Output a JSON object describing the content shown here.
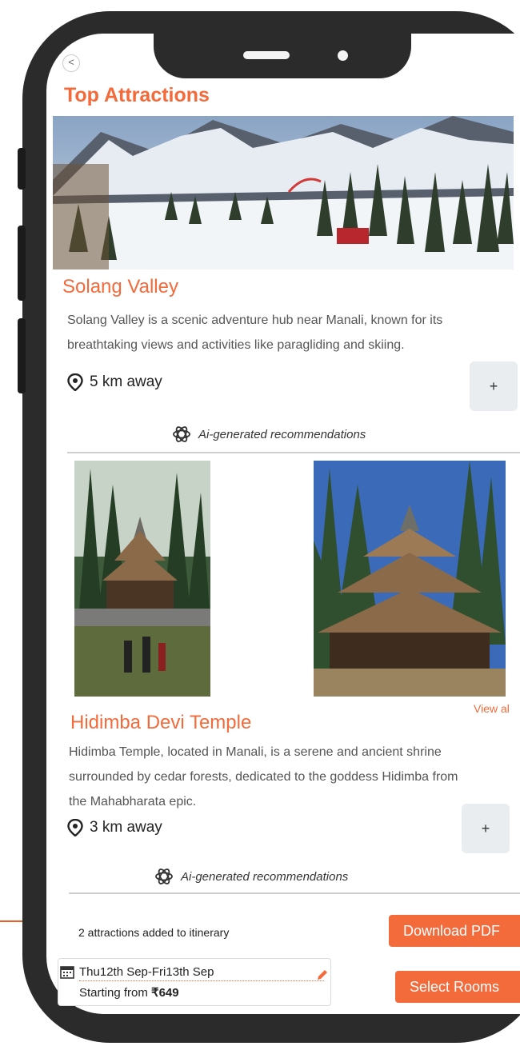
{
  "header": {
    "title": "Top Attractions",
    "back_label": "<"
  },
  "attractions": [
    {
      "name": "Solang Valley",
      "description_lines": [
        "Solang Valley is a scenic adventure hub near Manali, known for its",
        "breathtaking views and activities like paragliding and skiing."
      ],
      "distance": "5 km away",
      "add_label": "+",
      "ai_note": "Ai-generated recommendations"
    },
    {
      "name": "Hidimba Devi Temple",
      "description_lines": [
        "Hidimba Temple, located in Manali, is a serene and ancient shrine",
        "surrounded by cedar forests, dedicated to the goddess Hidimba from",
        "the Mahabharata epic."
      ],
      "distance": "3 km away",
      "add_label": "+",
      "ai_note": "Ai-generated recommendations"
    }
  ],
  "gallery": {
    "view_all_label": "View al"
  },
  "footer": {
    "added_text": "2 attractions added to itinerary",
    "download_label": "Download PDF",
    "dates": "Thu12th Sep-Fri13th Sep",
    "price_prefix": "Starting from ",
    "price_value": "₹649",
    "select_rooms_label": "Select Rooms"
  },
  "colors": {
    "accent": "#f36a3b",
    "phone_frame": "#2b2b2b"
  },
  "icons": [
    "back-icon",
    "location-pin-icon",
    "openai-logo-icon",
    "calendar-icon",
    "pencil-icon",
    "arrow-icon"
  ]
}
